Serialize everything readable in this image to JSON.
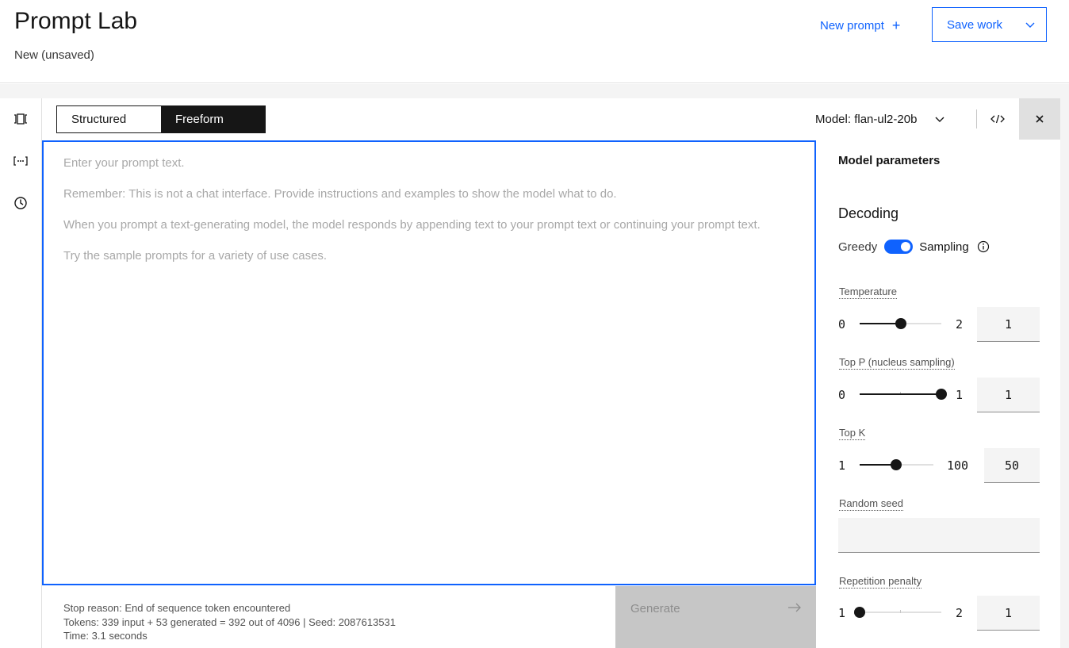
{
  "header": {
    "title": "Prompt Lab",
    "subtitle": "New (unsaved)",
    "new_prompt_label": "New prompt",
    "save_work_label": "Save work"
  },
  "rail": {
    "items": [
      "samples-icon",
      "variables-icon",
      "history-icon"
    ]
  },
  "toolbar": {
    "modes": [
      "Structured",
      "Freeform"
    ],
    "active_mode": "Freeform",
    "model_label": "Model: flan-ul2-20b"
  },
  "editor": {
    "placeholder_lines": [
      "Enter your prompt text.",
      "Remember: This is not a chat interface. Provide instructions and examples to show the model what to do.",
      "When you prompt a text-generating model, the model responds by appending text to your prompt text or continuing your prompt text.",
      "Try the sample prompts for a variety of use cases."
    ]
  },
  "footer": {
    "stop_reason": "Stop reason: End of sequence token encountered",
    "tokens": "Tokens: 339 input + 53 generated = 392 out of 4096 | Seed: 2087613531",
    "time": "Time: 3.1 seconds",
    "generate_label": "Generate"
  },
  "panel": {
    "title": "Model parameters",
    "decoding": {
      "title": "Decoding",
      "left_label": "Greedy",
      "right_label": "Sampling",
      "mode": "Sampling"
    },
    "temperature": {
      "label": "Temperature",
      "min": "0",
      "max": "2",
      "value": "1",
      "fraction": 0.5
    },
    "top_p": {
      "label": "Top P (nucleus sampling)",
      "min": "0",
      "max": "1",
      "value": "1",
      "fraction": 1.0
    },
    "top_k": {
      "label": "Top K",
      "min": "1",
      "max": "100",
      "value": "50",
      "fraction": 0.495
    },
    "random_seed": {
      "label": "Random seed",
      "value": ""
    },
    "repetition_penalty": {
      "label": "Repetition penalty",
      "min": "1",
      "max": "2",
      "value": "1",
      "fraction": 0.0
    }
  },
  "colors": {
    "accent": "#0f62fe",
    "dark": "#161616",
    "disabled_bg": "#c6c6c6"
  }
}
